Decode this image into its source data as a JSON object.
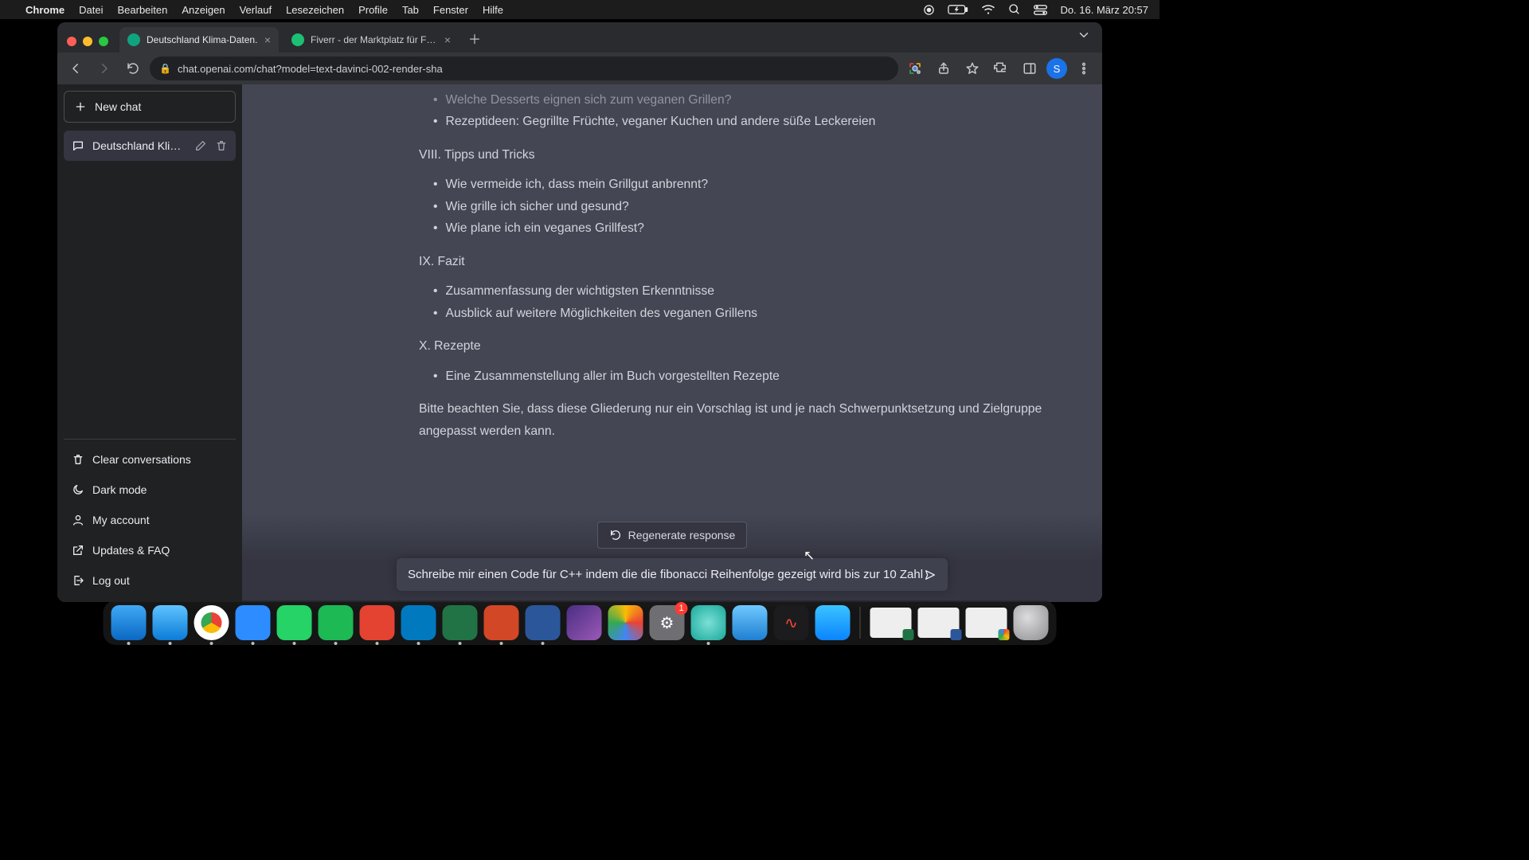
{
  "menubar": {
    "app": "Chrome",
    "items": [
      "Datei",
      "Bearbeiten",
      "Anzeigen",
      "Verlauf",
      "Lesezeichen",
      "Profile",
      "Tab",
      "Fenster",
      "Hilfe"
    ],
    "clock": "Do. 16. März  20:57"
  },
  "chrome": {
    "tabs": [
      {
        "title": "Deutschland Klima-Daten.",
        "active": true
      },
      {
        "title": "Fiverr - der Marktplatz für Fre…",
        "active": false
      }
    ],
    "url": "chat.openai.com/chat?model=text-davinci-002-render-sha",
    "profile_initial": "S"
  },
  "sidebar": {
    "new_chat": "New chat",
    "conversations": [
      {
        "title": "Deutschland Klima-Da"
      }
    ],
    "links": {
      "clear": "Clear conversations",
      "dark": "Dark mode",
      "account": "My account",
      "updates": "Updates & FAQ",
      "logout": "Log out"
    }
  },
  "message": {
    "top_clip_1": "Welche Desserts eignen sich zum veganen Grillen?",
    "top_clip_2": "Rezeptideen: Gegrillte Früchte, veganer Kuchen und andere süße Leckereien",
    "h8": "VIII. Tipps und Tricks",
    "list8": [
      "Wie vermeide ich, dass mein Grillgut anbrennt?",
      "Wie grille ich sicher und gesund?",
      "Wie plane ich ein veganes Grillfest?"
    ],
    "h9": "IX. Fazit",
    "list9": [
      "Zusammenfassung der wichtigsten Erkenntnisse",
      "Ausblick auf weitere Möglichkeiten des veganen Grillens"
    ],
    "h10": "X. Rezepte",
    "list10": [
      "Eine Zusammenstellung aller im Buch vorgestellten Rezepte"
    ],
    "closing": "Bitte beachten Sie, dass diese Gliederung nur ein Vorschlag ist und je nach Schwerpunktsetzung und Zielgruppe angepasst werden kann."
  },
  "bottom": {
    "regenerate": "Regenerate response",
    "input_value": "Schreibe mir einen Code für C++ indem die die fibonacci Reihenfolge gezeigt wird bis zur 10 Zahl"
  },
  "dock": {
    "settings_badge": "1"
  }
}
